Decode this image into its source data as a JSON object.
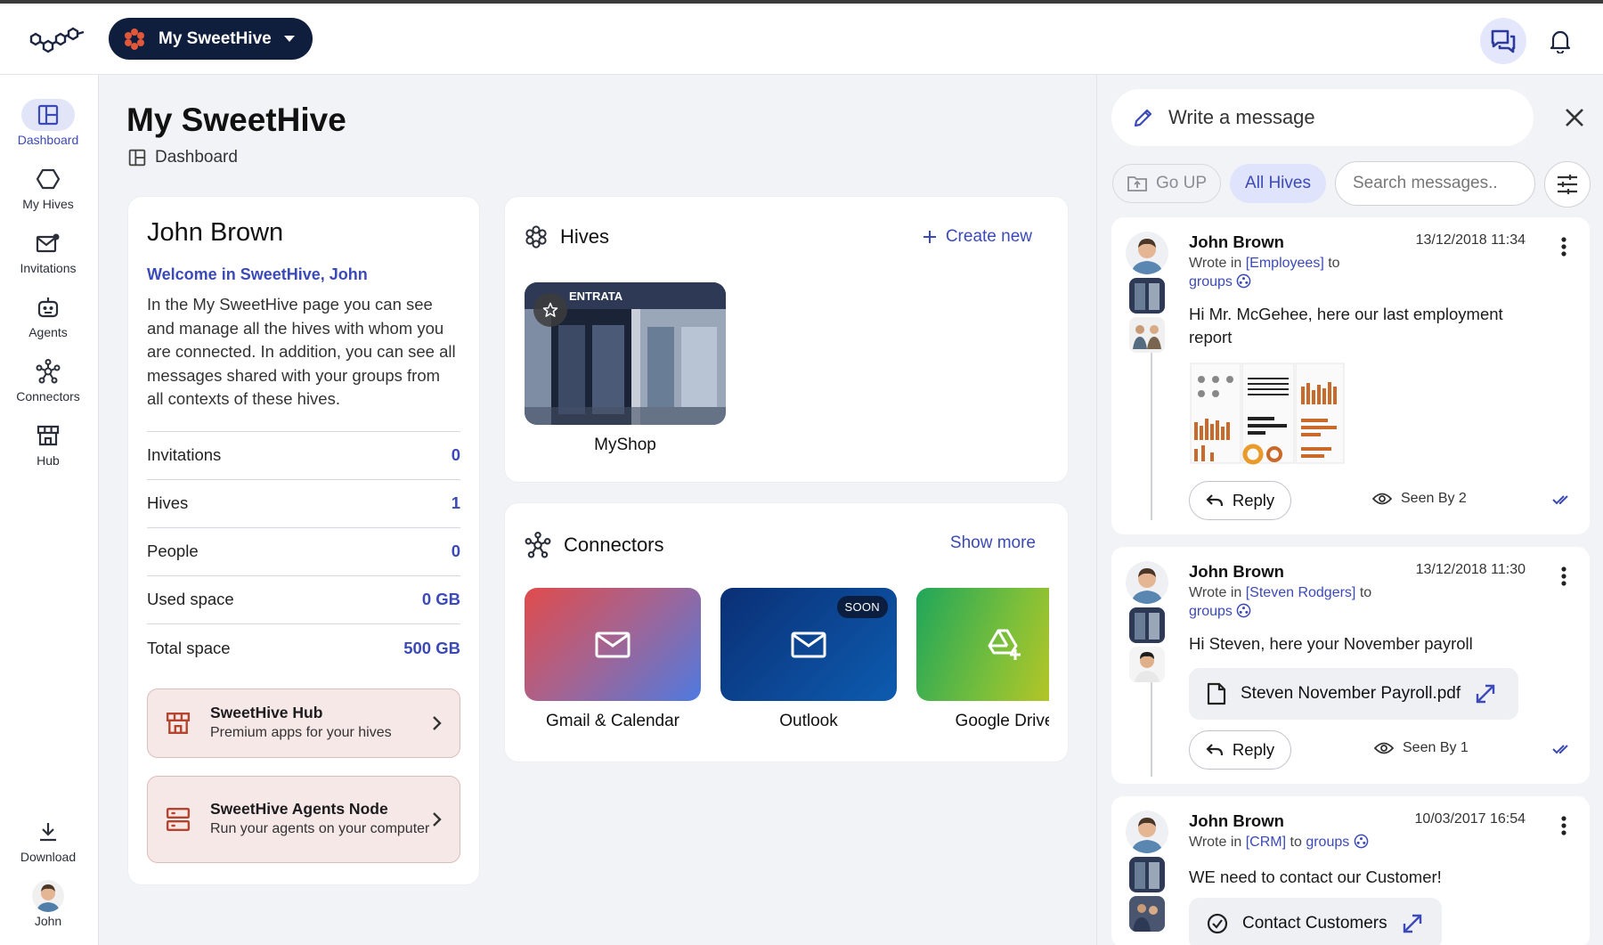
{
  "header": {
    "hive_switcher_label": "My SweetHive"
  },
  "nav": {
    "items": [
      {
        "label": "Dashboard",
        "icon": "dashboard-icon",
        "active": true
      },
      {
        "label": "My Hives",
        "icon": "hexagon-icon"
      },
      {
        "label": "Invitations",
        "icon": "mail-icon"
      },
      {
        "label": "Agents",
        "icon": "robot-icon"
      },
      {
        "label": "Connectors",
        "icon": "connectors-icon"
      },
      {
        "label": "Hub",
        "icon": "store-icon"
      }
    ],
    "download_label": "Download",
    "user_label": "John"
  },
  "page": {
    "title": "My SweetHive",
    "breadcrumb": "Dashboard"
  },
  "profile": {
    "name": "John Brown",
    "welcome": "Welcome in SweetHive, John",
    "description": "In the My SweetHive page you can see and manage all the hives with whom you are connected. In addition, you can see all messages shared with your groups from all contexts of these hives.",
    "stats": [
      {
        "label": "Invitations",
        "value": "0"
      },
      {
        "label": "Hives",
        "value": "1"
      },
      {
        "label": "People",
        "value": "0"
      },
      {
        "label": "Used space",
        "value": "0 GB"
      },
      {
        "label": "Total space",
        "value": "500 GB"
      }
    ],
    "promos": [
      {
        "title": "SweetHive Hub",
        "subtitle": "Premium apps for your hives"
      },
      {
        "title": "SweetHive Agents Node",
        "subtitle": "Run your agents on your computer"
      }
    ]
  },
  "hives": {
    "title": "Hives",
    "create_label": "Create new",
    "items": [
      {
        "name": "MyShop",
        "sign_text": "ENTRATA"
      }
    ]
  },
  "connectors": {
    "title": "Connectors",
    "show_more_label": "Show more",
    "items": [
      {
        "name": "Gmail & Calendar",
        "badge": ""
      },
      {
        "name": "Outlook",
        "badge": "SOON"
      },
      {
        "name": "Google Drive",
        "badge": ""
      }
    ]
  },
  "messages_panel": {
    "compose_placeholder": "Write a message",
    "go_up_label": "Go UP",
    "all_hives_label": "All Hives",
    "search_placeholder": "Search messages..",
    "messages": [
      {
        "author": "John Brown",
        "date": "13/12/2018 11:34",
        "wrote_in": "Wrote in",
        "context": "[Employees]",
        "to": "to",
        "target": "groups",
        "text": "Hi Mr. McGehee, here our last employment report",
        "reply_label": "Reply",
        "seen_label": "Seen By 2"
      },
      {
        "author": "John Brown",
        "date": "13/12/2018 11:30",
        "wrote_in": "Wrote in",
        "context": "[Steven Rodgers]",
        "to": "to",
        "target": "groups",
        "text": "Hi Steven, here your November payroll",
        "attachment": "Steven November Payroll.pdf",
        "reply_label": "Reply",
        "seen_label": "Seen By 1"
      },
      {
        "author": "John Brown",
        "date": "10/03/2017 16:54",
        "wrote_in": "Wrote in",
        "context": "[CRM]",
        "to": "to",
        "target": "groups",
        "text": "WE need to contact our Customer!",
        "attachment": "Contact Customers"
      }
    ]
  },
  "colors": {
    "accent": "#3b4ab8",
    "header_pill": "#0f1e3d",
    "promo_bg": "#f7e8e8",
    "promo_icon": "#b5432e"
  }
}
